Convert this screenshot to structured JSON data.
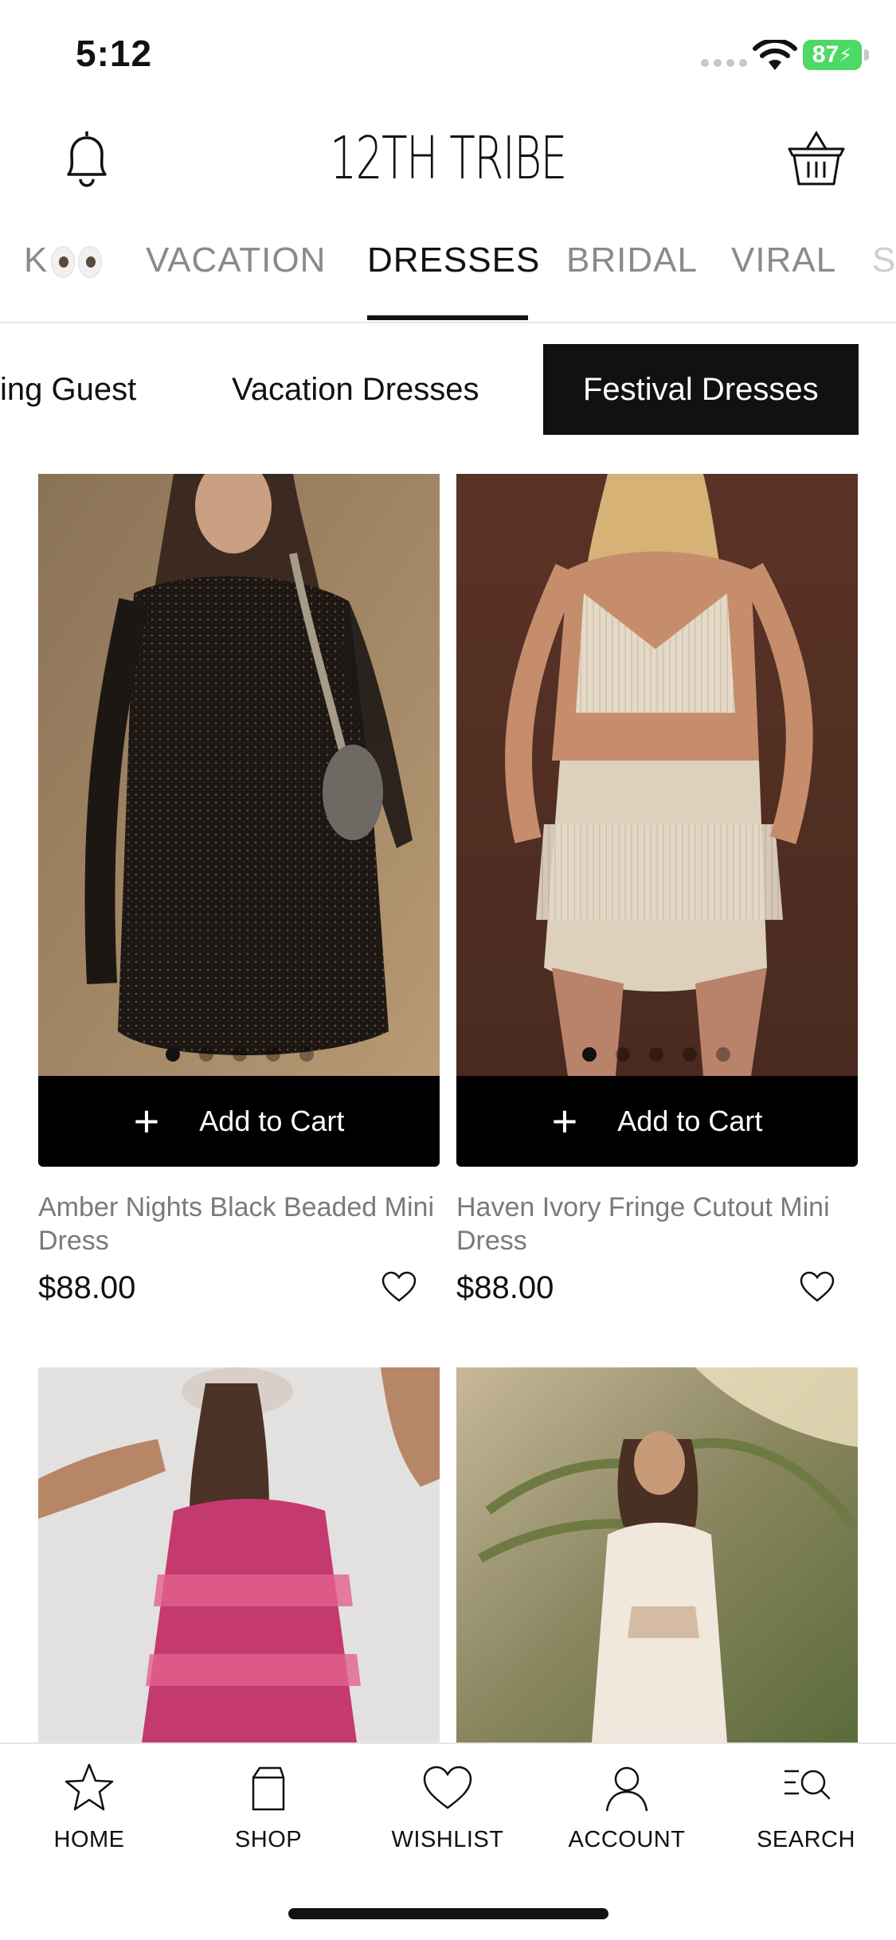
{
  "status_bar": {
    "time": "5:12",
    "battery": "87"
  },
  "header": {
    "brand": "12TH TRIBE"
  },
  "category_tabs": [
    {
      "label": "K",
      "has_eyes": true
    },
    {
      "label": "VACATION"
    },
    {
      "label": "DRESSES",
      "active": true
    },
    {
      "label": "BRIDAL"
    },
    {
      "label": "VIRAL"
    },
    {
      "label": "S"
    }
  ],
  "sub_tabs": [
    {
      "label": "ing Guest"
    },
    {
      "label": "Vacation Dresses"
    },
    {
      "label": "Festival Dresses",
      "active": true
    }
  ],
  "products": [
    {
      "name": "Amber Nights Black Beaded Mini Dress",
      "price": "$88.00",
      "add_label": "Add to Cart",
      "image_count": 5,
      "image_index": 0
    },
    {
      "name": "Haven Ivory Fringe Cutout Mini Dress",
      "price": "$88.00",
      "add_label": "Add to Cart",
      "image_count": 5,
      "image_index": 0
    },
    {
      "name": "",
      "price": ""
    },
    {
      "name": "",
      "price": ""
    }
  ],
  "bottom_nav": [
    {
      "label": "HOME",
      "icon": "star-icon"
    },
    {
      "label": "SHOP",
      "icon": "shopping-bag-icon"
    },
    {
      "label": "WISHLIST",
      "icon": "heart-icon"
    },
    {
      "label": "ACCOUNT",
      "icon": "person-icon"
    },
    {
      "label": "SEARCH",
      "icon": "search-icon"
    }
  ],
  "colors": {
    "accent": "#000000",
    "muted_text": "#8a8a8a",
    "battery": "#4cd964"
  }
}
